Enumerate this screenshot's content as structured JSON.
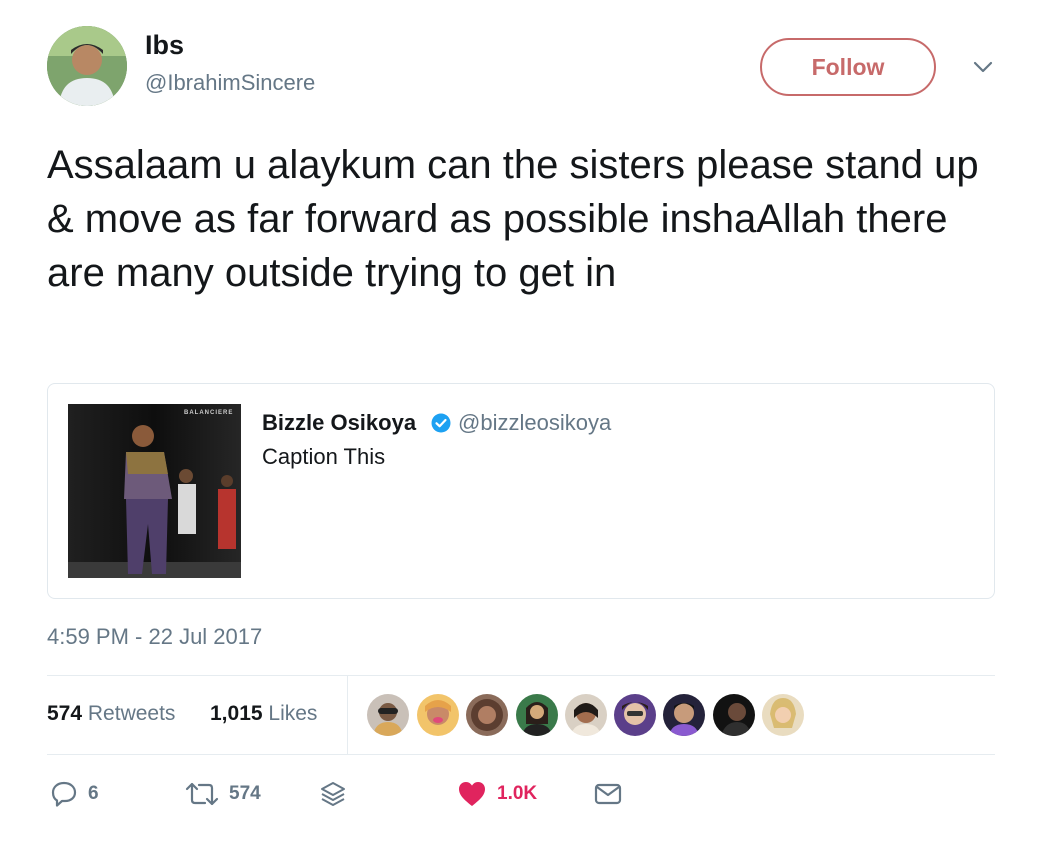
{
  "tweet": {
    "display_name": "Ibs",
    "handle": "@IbrahimSincere",
    "follow_label": "Follow",
    "text": "Assalaam u alaykum can the sisters please stand up & move as far forward as possible inshaAllah there are many outside trying to get in",
    "timestamp": "4:59 PM - 22 Jul 2017"
  },
  "quote": {
    "name": "Bizzle Osikoya",
    "handle": "@bizzleosikoya",
    "text": "Caption This",
    "image_text": "BALANCIERE"
  },
  "stats": {
    "retweets_count": "574",
    "retweets_label": "Retweets",
    "likes_count": "1,015",
    "likes_label": "Likes"
  },
  "actions": {
    "reply_count": "6",
    "retweet_count": "574",
    "like_count": "1.0K"
  },
  "icons": {
    "reply": "reply-icon",
    "retweet": "retweet-icon",
    "stack": "stack-icon",
    "like": "heart-icon",
    "dm": "envelope-icon",
    "verified": "verified-icon",
    "more": "chevron-down-icon"
  },
  "colors": {
    "follow": "#c76a6a",
    "like": "#e0245e",
    "muted": "#657786",
    "verified": "#1da1f2"
  }
}
